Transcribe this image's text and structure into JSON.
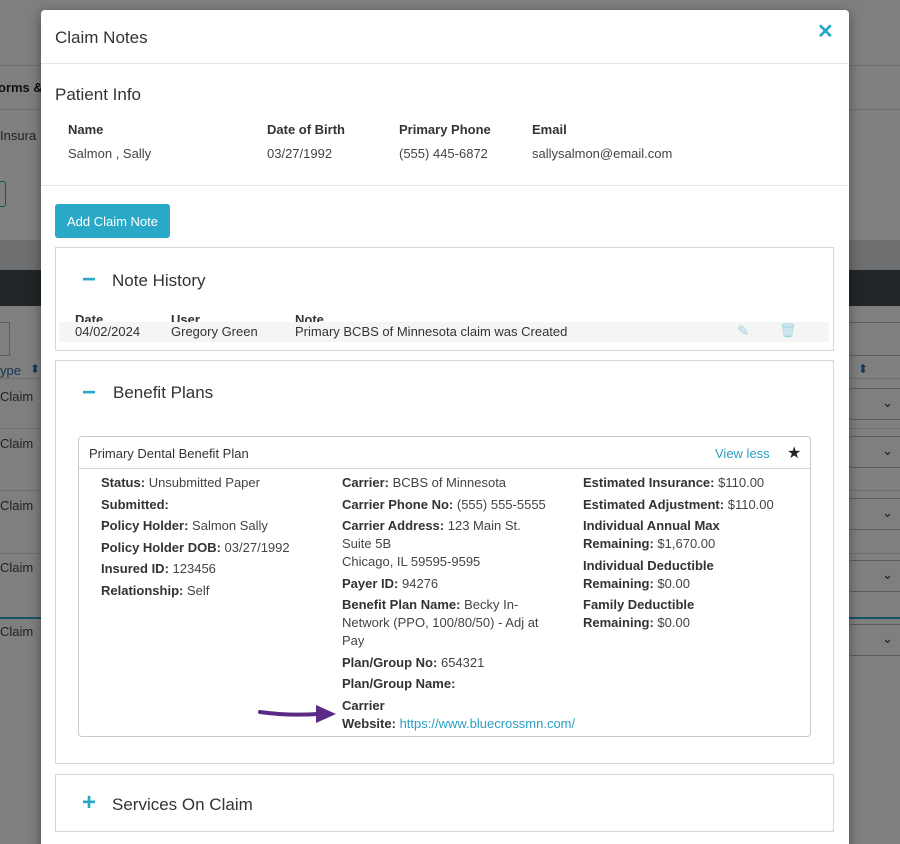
{
  "background": {
    "tab_label": "orms &",
    "tab2_label": "Insura",
    "col_label": "ype",
    "claim_label": "Claim"
  },
  "modal": {
    "title": "Claim Notes",
    "close_glyph": "✕"
  },
  "patient": {
    "section_title": "Patient Info",
    "name_label": "Name",
    "name_value": "Salmon , Sally",
    "dob_label": "Date of Birth",
    "dob_value": "03/27/1992",
    "phone_label": "Primary Phone",
    "phone_value": "(555) 445-6872",
    "email_label": "Email",
    "email_value": "sallysalmon@email.com"
  },
  "actions": {
    "add_note_label": "Add Claim Note"
  },
  "note_history": {
    "title": "Note History",
    "toggle": "−",
    "columns": {
      "date": "Date",
      "user": "User",
      "note": "Note"
    },
    "rows": [
      {
        "date": "04/02/2024",
        "user": "Gregory Green",
        "note": "Primary BCBS of Minnesota claim was Created"
      }
    ]
  },
  "benefit_plans": {
    "title": "Benefit Plans",
    "toggle": "−",
    "plan": {
      "name": "Primary Dental Benefit Plan",
      "view_less": "View less",
      "status_label": "Status:",
      "status_value": "Unsubmitted Paper",
      "submitted_label": "Submitted:",
      "policy_holder_label": "Policy Holder:",
      "policy_holder_value": "Salmon Sally",
      "policy_holder_dob_label": "Policy Holder DOB:",
      "policy_holder_dob_value": "03/27/1992",
      "insured_id_label": "Insured ID:",
      "insured_id_value": "123456",
      "relationship_label": "Relationship:",
      "relationship_value": "Self",
      "carrier_label": "Carrier:",
      "carrier_value": "BCBS of Minnesota",
      "carrier_phone_label": "Carrier Phone No:",
      "carrier_phone_value": "(555) 555-5555",
      "carrier_address_label": "Carrier Address:",
      "carrier_address_line1": "123 Main St.",
      "carrier_address_line2": "Suite 5B",
      "carrier_address_line3": "Chicago, IL 59595-9595",
      "payer_id_label": "Payer ID:",
      "payer_id_value": "94276",
      "benefit_plan_name_label": "Benefit Plan Name:",
      "benefit_plan_name_line1": "Becky In-",
      "benefit_plan_name_line2": "Network (PPO, 100/80/50) - Adj at",
      "benefit_plan_name_line3": "Pay",
      "plan_group_no_label": "Plan/Group No:",
      "plan_group_no_value": "654321",
      "plan_group_name_label": "Plan/Group Name:",
      "carrier_website_label_line1": "Carrier",
      "carrier_website_label_line2": "Website:",
      "carrier_website_value": "https://www.bluecrossmn.com/",
      "est_insurance_label": "Estimated Insurance:",
      "est_insurance_value": "$110.00",
      "est_adjustment_label": "Estimated Adjustment:",
      "est_adjustment_value": "$110.00",
      "ind_annual_max_label_line1": "Individual Annual Max",
      "ind_annual_max_label_line2": "Remaining:",
      "ind_annual_max_value": "$1,670.00",
      "ind_deductible_label_line1": "Individual Deductible",
      "ind_deductible_label_line2": "Remaining:",
      "ind_deductible_value": "$0.00",
      "fam_deductible_label_line1": "Family Deductible",
      "fam_deductible_label_line2": "Remaining:",
      "fam_deductible_value": "$0.00"
    }
  },
  "services": {
    "title": "Services On Claim",
    "toggle": "+"
  },
  "colors": {
    "accent": "#2aa8c8",
    "link": "#2a9fc4",
    "arrow": "#5b2a86"
  },
  "icons": {
    "edit": "edit-icon",
    "trash": "trash-icon",
    "star": "star-icon",
    "close": "close-icon"
  }
}
